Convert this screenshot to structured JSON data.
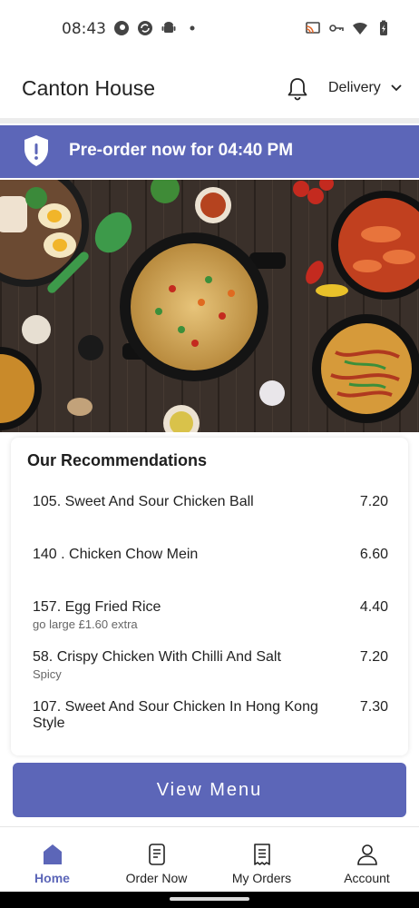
{
  "status_bar": {
    "time": "08:43",
    "left_icons": [
      "pinterest-icon",
      "sync-icon",
      "android-icon",
      "dot-icon"
    ],
    "right_icons": [
      "cast-icon",
      "key-icon",
      "wifi-icon",
      "battery-icon"
    ]
  },
  "header": {
    "title": "Canton House",
    "bell_icon": "bell-icon",
    "delivery_label": "Delivery"
  },
  "banner": {
    "text": "Pre-order now for 04:40 PM",
    "icon": "shield-alert-icon",
    "color": "#5c66b8"
  },
  "hero": {
    "description_icon": "food-photo"
  },
  "recommendations": {
    "title": "Our Recommendations",
    "items": [
      {
        "name": "105. Sweet And Sour Chicken Ball",
        "price": "7.20",
        "note": ""
      },
      {
        "name": "140 . Chicken Chow Mein",
        "price": "6.60",
        "note": ""
      },
      {
        "name": "157. Egg Fried Rice",
        "price": "4.40",
        "note": "go large £1.60 extra"
      },
      {
        "name": "58. Crispy Chicken With Chilli And Salt",
        "price": "7.20",
        "note": "Spicy"
      },
      {
        "name": "107. Sweet And Sour Chicken In Hong Kong Style",
        "price": "7.30",
        "note": ""
      }
    ]
  },
  "view_menu": {
    "label": "View Menu"
  },
  "bottom_nav": {
    "items": [
      {
        "label": "Home",
        "icon": "home-icon",
        "active": true
      },
      {
        "label": "Order Now",
        "icon": "order-icon",
        "active": false
      },
      {
        "label": "My Orders",
        "icon": "receipt-icon",
        "active": false
      },
      {
        "label": "Account",
        "icon": "account-icon",
        "active": false
      }
    ]
  },
  "accent_color": "#5c66b8"
}
